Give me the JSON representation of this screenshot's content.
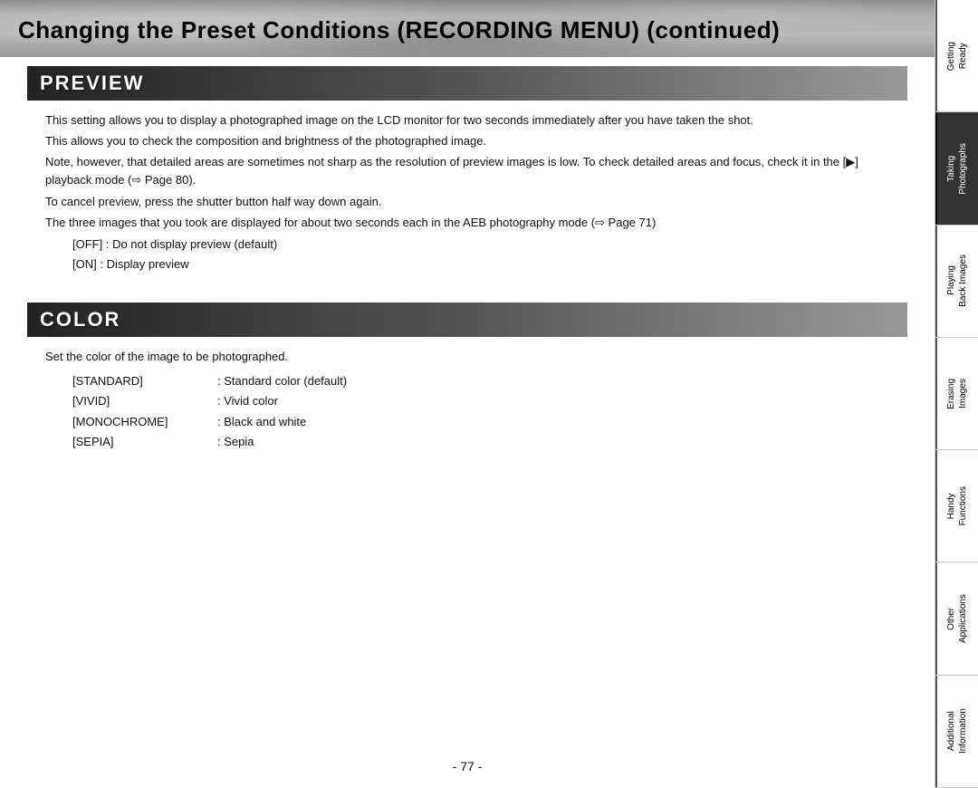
{
  "header": {
    "title": "Changing the Preset Conditions (RECORDING MENU) (continued)"
  },
  "preview_section": {
    "heading": "PREVIEW",
    "paragraphs": [
      "This setting allows you to display a photographed image on the LCD monitor for two seconds immediately after you have taken the shot.",
      "This allows you to check the composition and brightness of the photographed image.",
      "Note, however, that detailed areas are sometimes not sharp as the resolution of preview images is low. To check detailed areas and focus, check it in the [ ▶ ] playback mode (⇨ Page 80).",
      "To cancel preview, press the shutter button half way down again.",
      "The three images that you took are displayed for about two seconds each in the AEB photography mode (⇨ Page 71)"
    ],
    "off_label": "[OFF]",
    "off_desc": ": Do not display preview (default)",
    "on_label": "[ON]",
    "on_desc": ": Display preview"
  },
  "color_section": {
    "heading": "COLOR",
    "intro": "Set the color of the image to be photographed.",
    "items": [
      {
        "label": "[STANDARD]",
        "desc": ": Standard color (default)"
      },
      {
        "label": "[VIVID]",
        "desc": ": Vivid color"
      },
      {
        "label": "[MONOCHROME]",
        "desc": ": Black and white"
      },
      {
        "label": "[SEPIA]",
        "desc": ": Sepia"
      }
    ]
  },
  "page_number": "- 77 -",
  "sidebar": {
    "items": [
      {
        "id": "getting-ready",
        "label": "Getting\nReady",
        "active": false
      },
      {
        "id": "taking-photographs",
        "label": "Taking\nPhotographs",
        "active": true
      },
      {
        "id": "playing-back-images",
        "label": "Playing\nBack Images",
        "active": false
      },
      {
        "id": "erasing-images",
        "label": "Erasing\nImages",
        "active": false
      },
      {
        "id": "handy-functions",
        "label": "Handy\nFunctions",
        "active": false
      },
      {
        "id": "other-applications",
        "label": "Other\nApplications",
        "active": false
      },
      {
        "id": "additional-information",
        "label": "Additional\nInformation",
        "active": false
      }
    ]
  }
}
